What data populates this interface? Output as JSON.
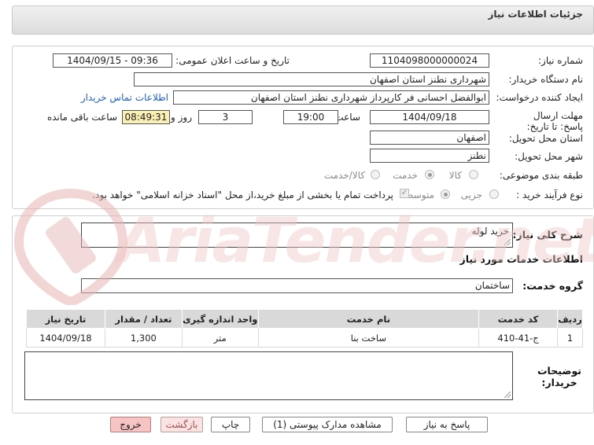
{
  "header": {
    "title": "جزئیات اطلاعات نیاز"
  },
  "form": {
    "need_number": {
      "label": "شماره نیاز:",
      "value": "1104098000000024"
    },
    "announce": {
      "label": "تاریخ و ساعت اعلان عمومی:",
      "value": "1404/09/15 - 09:36"
    },
    "buyer_org": {
      "label": "نام دستگاه خریدار:",
      "value": "شهرداری نطنز استان اصفهان"
    },
    "creator": {
      "label": "ایجاد کننده درخواست:",
      "value": "ابوالفضل احسانی فر کارپرداز شهرداری نطنز استان اصفهان",
      "contact_link": "اطلاعات تماس خریدار"
    },
    "deadline": {
      "label": "مهلت ارسال پاسخ: تا تاریخ:",
      "date": "1404/09/18",
      "time_label": "ساعت",
      "time": "19:00",
      "days": "3",
      "days_label": "روز و",
      "remaining": "08:49:31",
      "remaining_label": "ساعت باقی مانده"
    },
    "province": {
      "label": "استان محل تحویل:",
      "value": "اصفهان"
    },
    "city": {
      "label": "شهر محل تحویل:",
      "value": "نطنز"
    },
    "category": {
      "label": "طبقه بندی موضوعی:",
      "options": [
        "کالا",
        "خدمت",
        "کالا/خدمت"
      ],
      "selected": "خدمت"
    },
    "purchase_type": {
      "label": "نوع فرآیند خرید :",
      "options": [
        "جزیی",
        "متوسط"
      ],
      "selected": "متوسط",
      "payment_note": "پرداخت تمام یا بخشی از مبلغ خرید،از محل \"اسناد خزانه اسلامی\" خواهد بود."
    }
  },
  "summary": {
    "label": "شرح کلی نیاز:",
    "value": "خرید لوله"
  },
  "services_heading": "اطلاعات خدمات مورد نیاز",
  "service_group": {
    "label": "گروه خدمت:",
    "value": "ساختمان"
  },
  "table": {
    "headers": [
      "ردیف",
      "کد خدمت",
      "نام خدمت",
      "واحد اندازه گیری",
      "تعداد / مقدار",
      "تاریخ نیاز"
    ],
    "rows": [
      [
        "1",
        "ج-41-410",
        "ساخت بنا",
        "متر",
        "1,300",
        "1404/09/18"
      ]
    ]
  },
  "buyer_notes": {
    "label": "توضیحات خریدار:",
    "value": ""
  },
  "buttons": {
    "reply": "پاسخ به نیاز",
    "docs": "مشاهده مدارک پیوستی (1)",
    "print": "چاپ",
    "back": "بازگشت",
    "exit": "خروج"
  },
  "watermark": {
    "text": "AriaTender.net"
  },
  "colors": {
    "accent_link": "#1f5fbf",
    "remaining_bg": "#fbf0b4",
    "exit_bg": "#f7c4c4",
    "header_bg": "#e4e4e4"
  }
}
